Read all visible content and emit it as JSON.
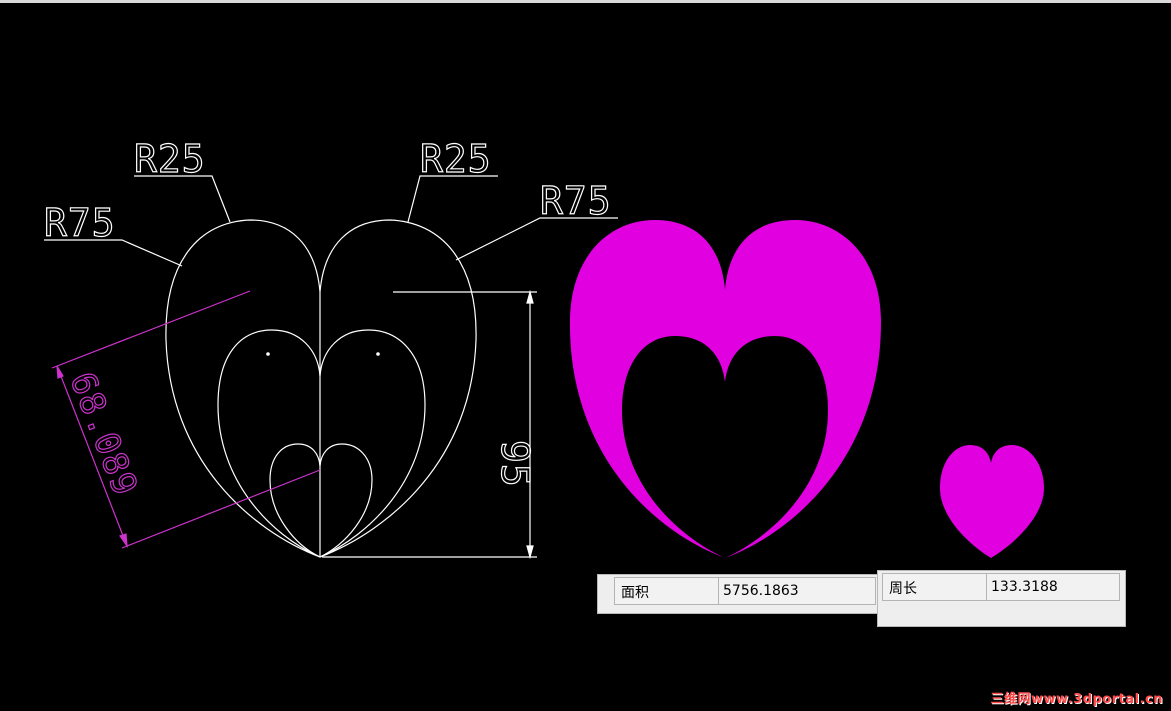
{
  "drawing": {
    "labels": {
      "r25_left": "R25",
      "r25_right": "R25",
      "r75_left": "R75",
      "r75_right": "R75",
      "dim_height": "95",
      "dim_diag": "68.089"
    },
    "colors": {
      "background": "#000000",
      "line": "#ffffff",
      "dimension": "#cc33cc",
      "fill": "#e000e0"
    }
  },
  "properties": {
    "area": {
      "label": "面积",
      "value": "5756.1863"
    },
    "perimeter": {
      "label": "周长",
      "value": "133.3188"
    }
  },
  "watermark": "三维网www.3dportal.cn"
}
